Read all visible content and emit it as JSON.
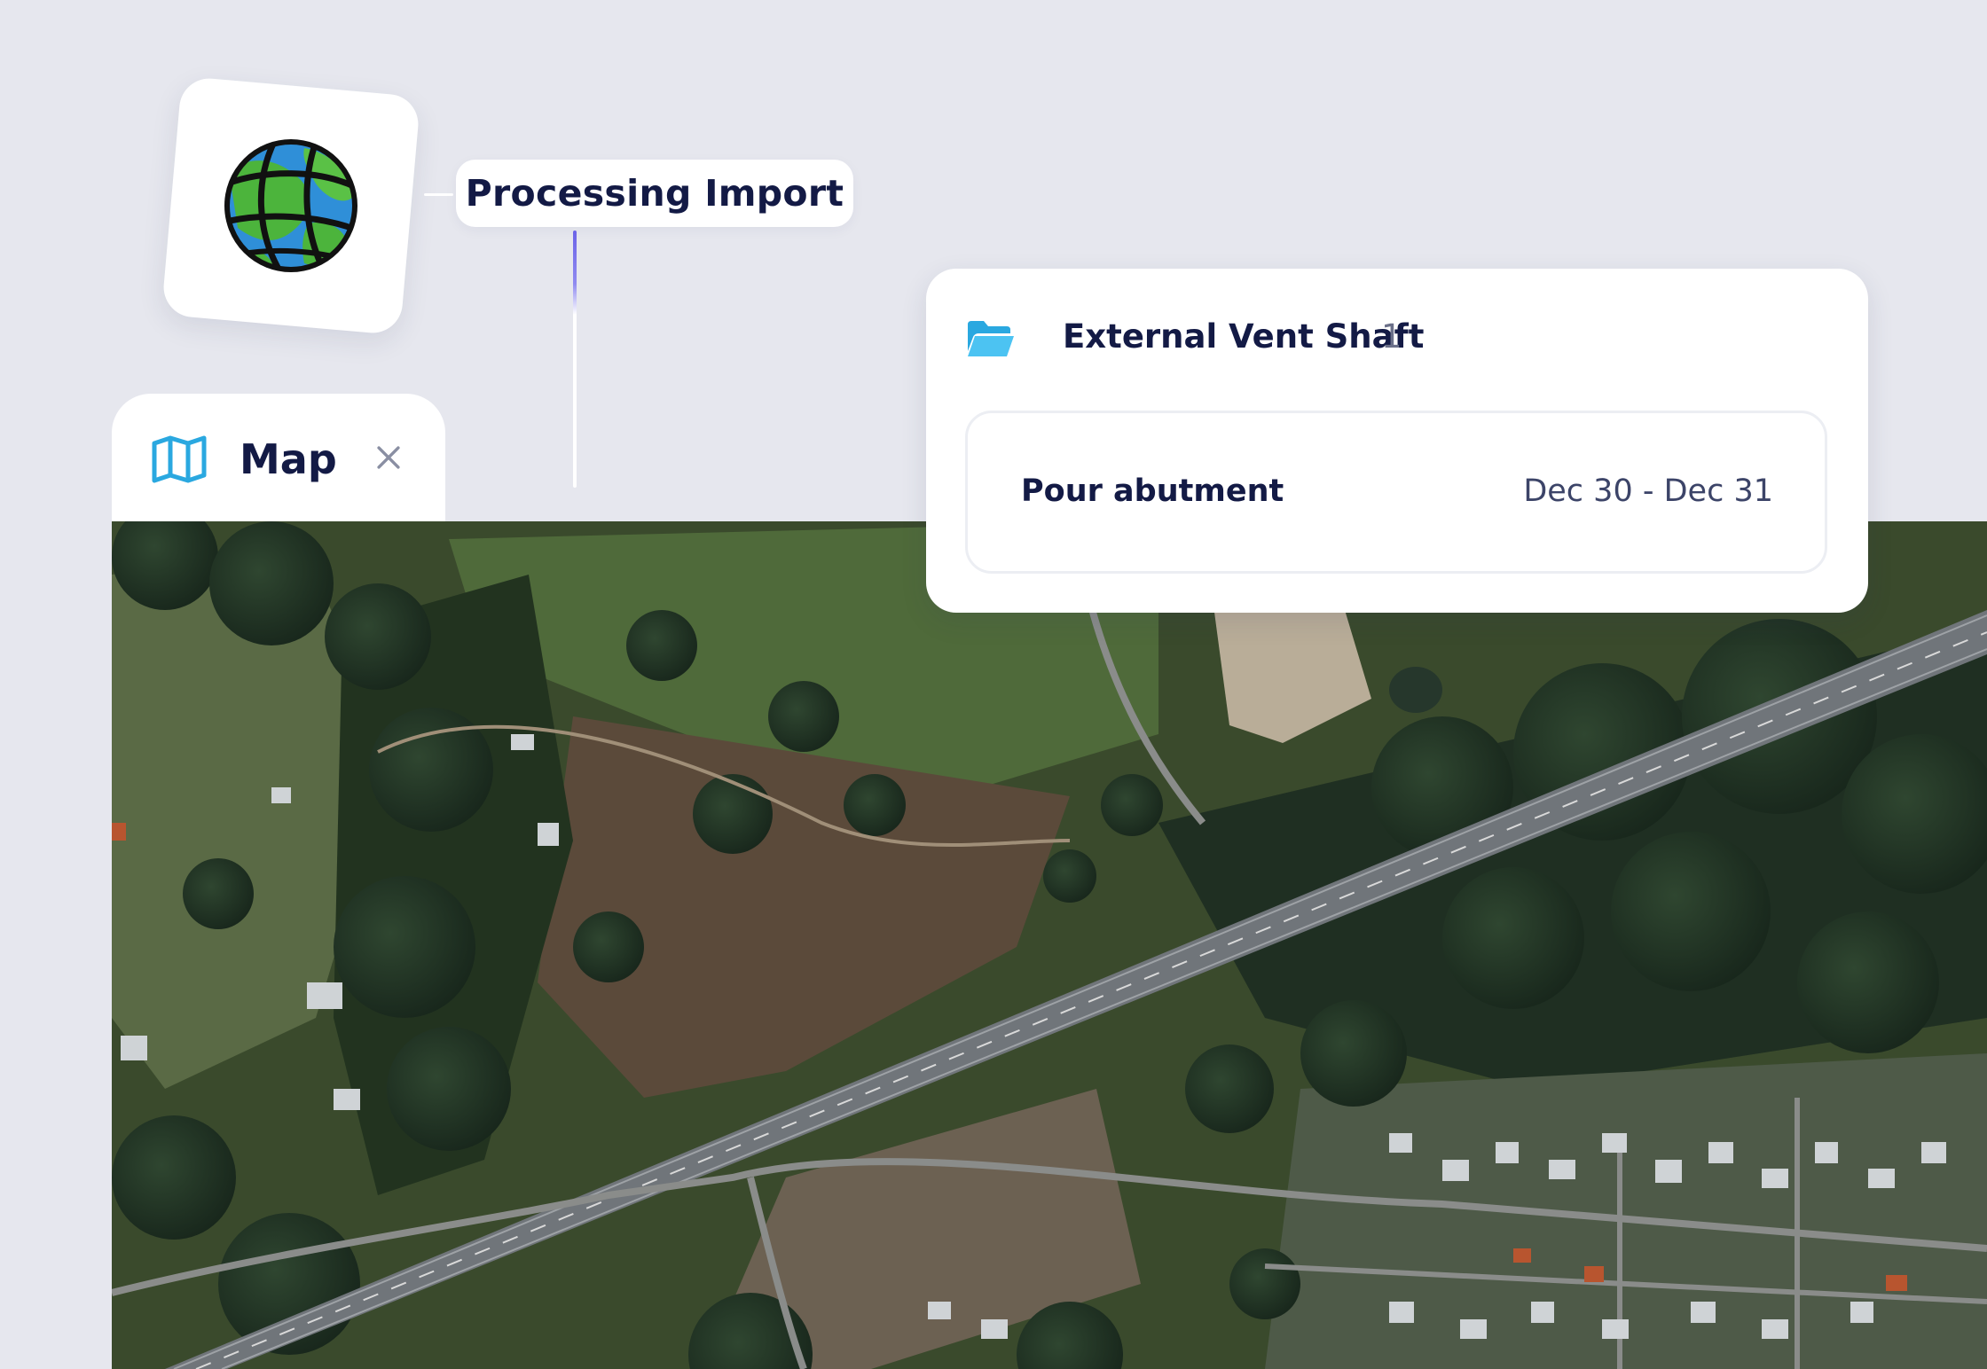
{
  "app": {
    "logo_icon": "globe-icon"
  },
  "status": {
    "processing_label": "Processing Import"
  },
  "map_tab": {
    "icon": "map-icon",
    "label": "Map",
    "close_icon": "close-icon"
  },
  "task_group": {
    "icon": "folder-open-icon",
    "title": "External Vent Shaft",
    "count": "1",
    "tasks": [
      {
        "name": "Pour abutment",
        "dates": "Dec 30 - Dec 31"
      }
    ]
  },
  "colors": {
    "background": "#e6e7ee",
    "text_primary": "#131a45",
    "accent_blue": "#2aa8e0",
    "connector_purple": "#6b63e8"
  }
}
